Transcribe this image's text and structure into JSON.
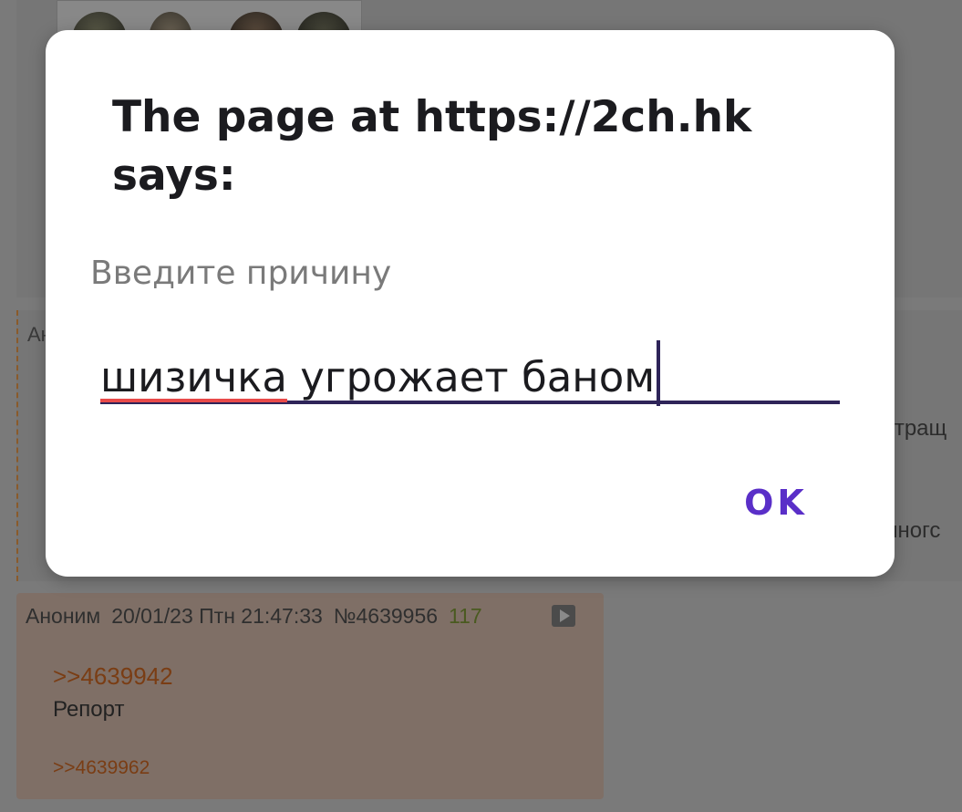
{
  "dialog": {
    "title": "The page at https://2ch.hk says:",
    "message": "Введите причину",
    "input": {
      "misspelled_word": "шизичка",
      "rest_text": " угрожает баном"
    },
    "ok_label": "OK"
  },
  "background": {
    "dashed_post": {
      "author_partial": "Ан",
      "text_fragment_1": "отращ",
      "text_fragment_2": "многс"
    },
    "post": {
      "author": "Аноним",
      "date": "20/01/23 Птн 21:47:33",
      "number": "№4639956",
      "replies_count": "117",
      "reply_link": ">>4639942",
      "body": "Репорт",
      "reply_ref": ">>4639962"
    }
  },
  "colors": {
    "accent": "#5a2fc8",
    "input_underline": "#2e2459",
    "spellcheck": "#e84a4a",
    "link": "#c46a2a"
  }
}
